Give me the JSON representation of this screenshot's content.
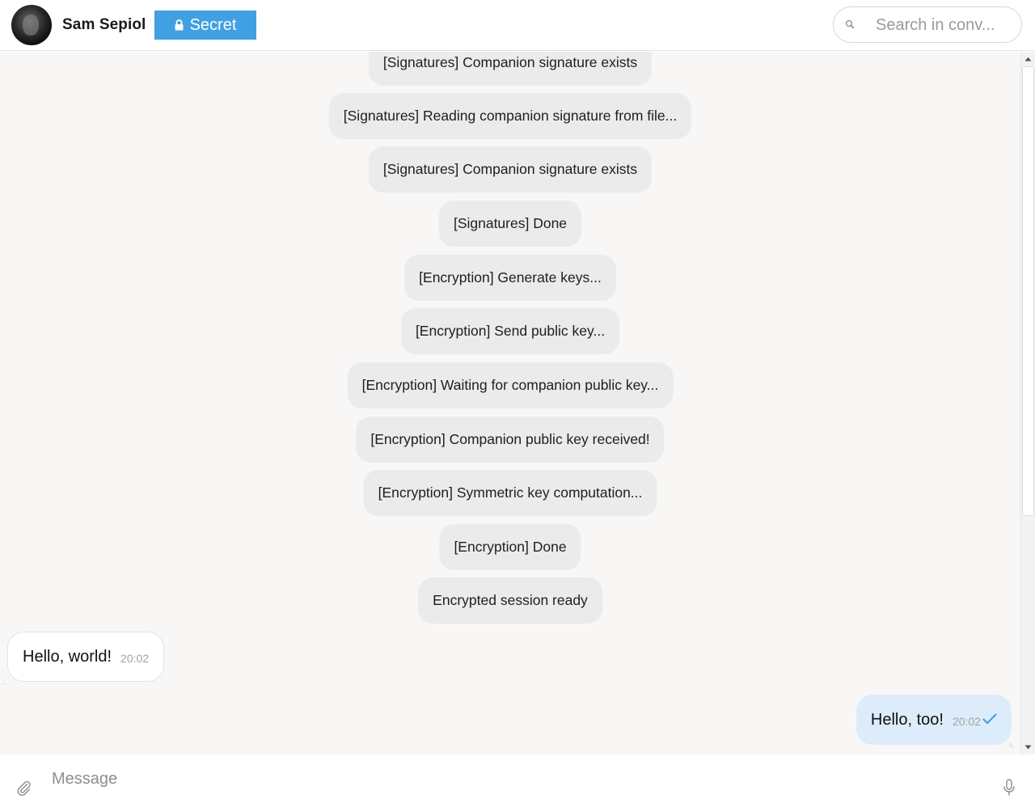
{
  "header": {
    "contact_name": "Sam Sepiol",
    "secret_label": "Secret",
    "search_placeholder": "Search in conv..."
  },
  "system_messages": [
    "[Signatures] Companion signature exists",
    "[Signatures] Reading companion signature from file...",
    "[Signatures] Companion signature exists",
    "[Signatures] Done",
    "[Encryption] Generate keys...",
    "[Encryption] Send public key...",
    "[Encryption] Waiting for companion public key...",
    "[Encryption] Companion public key received!",
    "[Encryption] Symmetric key computation...",
    "[Encryption] Done",
    "Encrypted session ready"
  ],
  "messages": {
    "incoming": {
      "text": "Hello, world!",
      "time": "20:02"
    },
    "outgoing": {
      "text": "Hello, too!",
      "time": "20:02",
      "status_icon": "check-icon"
    }
  },
  "composer": {
    "placeholder": "Message"
  },
  "colors": {
    "secret_badge": "#40a0e2",
    "outgoing_bubble": "#dcecfa",
    "system_bubble": "#ebebeb",
    "chat_background": "#f8f7f6",
    "check_mark": "#3d9be0"
  }
}
